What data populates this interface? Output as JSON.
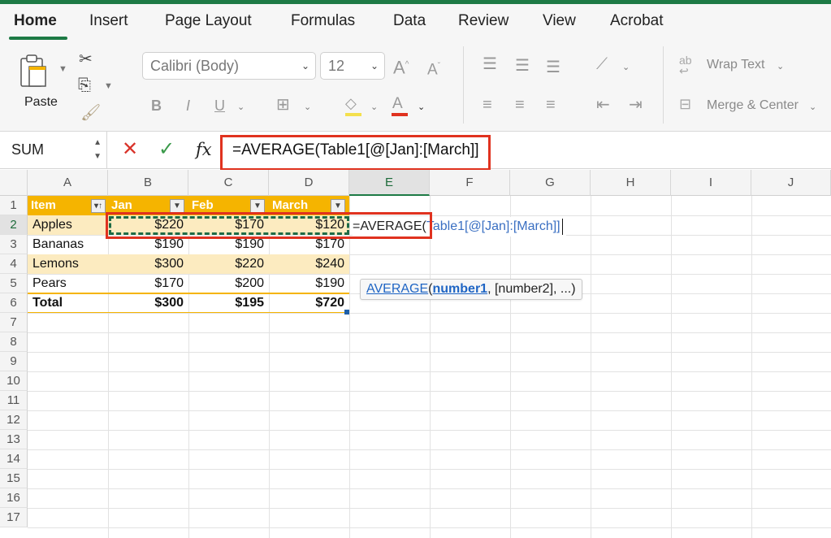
{
  "ribbon": {
    "tabs": [
      "Home",
      "Insert",
      "Page Layout",
      "Formulas",
      "Data",
      "Review",
      "View",
      "Acrobat"
    ],
    "active_tab": "Home",
    "paste_label": "Paste",
    "font_name": "Calibri (Body)",
    "font_size": "12",
    "bold_label": "B",
    "italic_label": "I",
    "underline_label": "U",
    "wrap_text_label": "Wrap Text",
    "merge_center_label": "Merge & Center"
  },
  "formula_bar": {
    "name_box": "SUM",
    "cancel_glyph": "✕",
    "enter_glyph": "✓",
    "fx_label": "fx",
    "formula": "=AVERAGE(Table1[@[Jan]:[March]]"
  },
  "grid": {
    "columns": [
      "A",
      "B",
      "C",
      "D",
      "E",
      "F",
      "G",
      "H",
      "I",
      "J"
    ],
    "selected_column": "E",
    "rows": [
      "1",
      "2",
      "3",
      "4",
      "5",
      "6",
      "7",
      "8",
      "9",
      "10",
      "11",
      "12",
      "13",
      "14",
      "15",
      "16",
      "17"
    ],
    "selected_row": "2",
    "table_headers": [
      "Item",
      "Jan",
      "Feb",
      "March"
    ],
    "table_rows": [
      {
        "item": "Apples",
        "jan": "$220",
        "feb": "$170",
        "march": "$120"
      },
      {
        "item": "Bananas",
        "jan": "$190",
        "feb": "$190",
        "march": "$170"
      },
      {
        "item": "Lemons",
        "jan": "$300",
        "feb": "$220",
        "march": "$240"
      },
      {
        "item": "Pears",
        "jan": "$170",
        "feb": "$200",
        "march": "$190"
      }
    ],
    "total_row": {
      "item": "Total",
      "jan": "$300",
      "feb": "$195",
      "march": "$720"
    },
    "edit_cell": {
      "prefix": "=AVERAGE(",
      "reference": "Table1[@[Jan]:[March]]"
    },
    "tooltip": {
      "function": "AVERAGE",
      "open": "(",
      "arg1": "number1",
      "rest": ", [number2], ...)"
    }
  },
  "colors": {
    "accent": "#1d7a45",
    "table_header": "#f5b400",
    "table_band": "#fcebc0",
    "highlight_box": "#e0321f",
    "marquee": "#1e6b45"
  }
}
